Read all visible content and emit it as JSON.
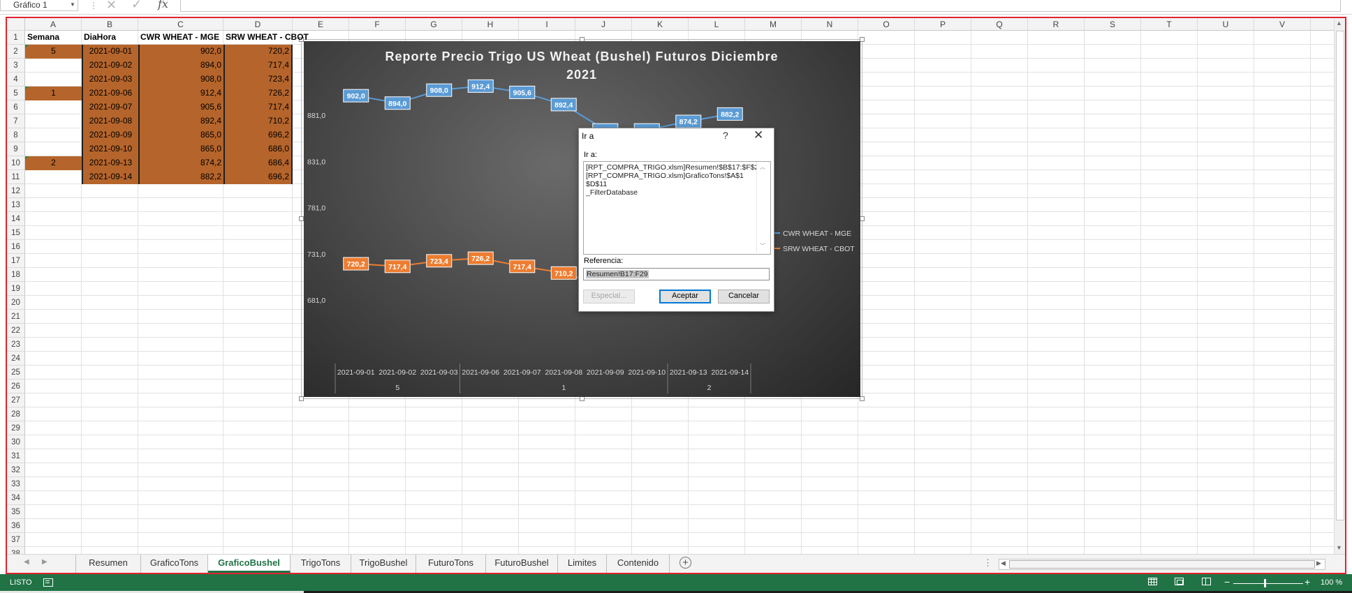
{
  "formula_bar": {
    "name_box": "Gráfico 1",
    "cancel_icon": "cancel-x-icon",
    "enter_icon": "enter-check-icon",
    "fx_label": "fx",
    "formula": ""
  },
  "columns": [
    "A",
    "B",
    "C",
    "D",
    "E",
    "F",
    "G",
    "H",
    "I",
    "J",
    "K",
    "L",
    "M",
    "N",
    "O",
    "P",
    "Q",
    "R",
    "S",
    "T",
    "U",
    "V",
    "W"
  ],
  "rows": [
    "1",
    "2",
    "3",
    "4",
    "5",
    "6",
    "7",
    "8",
    "9",
    "10",
    "11",
    "12",
    "13",
    "14",
    "15",
    "16",
    "17",
    "18",
    "19",
    "20",
    "21",
    "22",
    "23",
    "24",
    "25",
    "26",
    "27",
    "28",
    "29",
    "30",
    "31",
    "32",
    "33",
    "34",
    "35",
    "36",
    "37",
    "38"
  ],
  "table": {
    "headers": [
      "Semana",
      "DiaHora",
      "CWR WHEAT - MGE",
      "SRW WHEAT - CBOT"
    ],
    "rows": [
      {
        "semana": "5",
        "dia": "2021-09-01",
        "cwr": "902,0",
        "srw": "720,2"
      },
      {
        "semana": "",
        "dia": "2021-09-02",
        "cwr": "894,0",
        "srw": "717,4"
      },
      {
        "semana": "",
        "dia": "2021-09-03",
        "cwr": "908,0",
        "srw": "723,4"
      },
      {
        "semana": "1",
        "dia": "2021-09-06",
        "cwr": "912,4",
        "srw": "726,2"
      },
      {
        "semana": "",
        "dia": "2021-09-07",
        "cwr": "905,6",
        "srw": "717,4"
      },
      {
        "semana": "",
        "dia": "2021-09-08",
        "cwr": "892,4",
        "srw": "710,2"
      },
      {
        "semana": "",
        "dia": "2021-09-09",
        "cwr": "865,0",
        "srw": "696,2"
      },
      {
        "semana": "",
        "dia": "2021-09-10",
        "cwr": "865,0",
        "srw": "686,0"
      },
      {
        "semana": "2",
        "dia": "2021-09-13",
        "cwr": "874,2",
        "srw": "686,4"
      },
      {
        "semana": "",
        "dia": "2021-09-14",
        "cwr": "882,2",
        "srw": "696,2"
      }
    ]
  },
  "chart_data": {
    "type": "line",
    "title": "Reporte Precio Trigo US Wheat (Bushel) Futuros Diciembre 2021",
    "title_lines": [
      "Reporte Precio Trigo US Wheat (Bushel) Futuros Diciembre",
      "2021"
    ],
    "categories": [
      "2021-09-01",
      "2021-09-02",
      "2021-09-03",
      "2021-09-06",
      "2021-09-07",
      "2021-09-08",
      "2021-09-09",
      "2021-09-10",
      "2021-09-13",
      "2021-09-14"
    ],
    "category_groups": [
      {
        "label": "5",
        "start": 0,
        "end": 2
      },
      {
        "label": "1",
        "start": 3,
        "end": 7
      },
      {
        "label": "2",
        "start": 8,
        "end": 9
      }
    ],
    "series": [
      {
        "name": "CWR WHEAT - MGE",
        "color": "#5b9bd5",
        "values": [
          902.0,
          894.0,
          908.0,
          912.4,
          905.6,
          892.4,
          865.0,
          865.0,
          874.2,
          882.2
        ],
        "labels": [
          "902,0",
          "894,0",
          "908,0",
          "912,4",
          "905,6",
          "892,4",
          "865,0",
          "865,0",
          "874,2",
          "882,2"
        ]
      },
      {
        "name": "SRW WHEAT - CBOT",
        "color": "#ed7d31",
        "values": [
          720.2,
          717.4,
          723.4,
          726.2,
          717.4,
          710.2,
          696.2,
          686.0,
          686.4,
          696.2
        ],
        "labels": [
          "720,2",
          "717,4",
          "723,4",
          "726,2",
          "717,4",
          "710,2",
          "696,2",
          "686,0",
          "686,4",
          "696,2"
        ]
      }
    ],
    "y_ticks": [
      "881,0",
      "831,0",
      "781,0",
      "731,0",
      "681,0"
    ],
    "y_tick_values": [
      881,
      831,
      781,
      731,
      681
    ],
    "ylim": [
      681,
      931
    ],
    "legend_position": "right",
    "grid": false
  },
  "dialog": {
    "title": "Ir a",
    "help": "?",
    "goto_label": "Ir a:",
    "goto_items": [
      "[RPT_COMPRA_TRIGO.xlsm]Resumen!$B$17:$F$2",
      "[RPT_COMPRA_TRIGO.xlsm]GraficoTons!$A$1",
      "$D$11",
      "_FilterDatabase"
    ],
    "reference_label": "Referencia:",
    "reference_value": "Resumen!B17:F29",
    "special_button": "Especial...",
    "accept_button": "Aceptar",
    "cancel_button": "Cancelar"
  },
  "sheet_tabs": [
    "Resumen",
    "GraficoTons",
    "GraficoBushel",
    "TrigoTons",
    "TrigoBushel",
    "FuturoTons",
    "FuturoBushel",
    "Limites",
    "Contenido"
  ],
  "active_tab": "GraficoBushel",
  "status": {
    "mode": "LISTO",
    "zoom": "100 %"
  },
  "colors": {
    "accent": "#217346",
    "cell_fill": "#b5652b",
    "frame": "#e0242f"
  }
}
